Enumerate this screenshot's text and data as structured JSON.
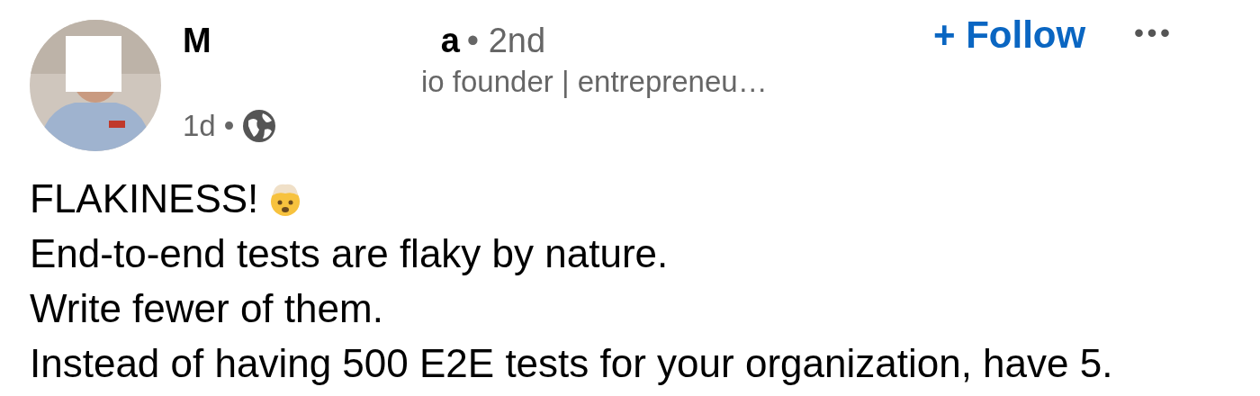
{
  "author": {
    "name_start": "M",
    "name_end": "a",
    "degree": "• 2nd",
    "headline": "io founder | entrepreneu…",
    "time": "1d •"
  },
  "follow_button": {
    "label": "+ Follow"
  },
  "more_button": {
    "label": "•••"
  },
  "post": {
    "lines": [
      {
        "text": "FLAKINESS!",
        "emoji": true
      },
      {
        "text": "End-to-end tests are flaky by nature.",
        "emoji": false
      },
      {
        "text": "Write fewer of them.",
        "emoji": false
      },
      {
        "text": "Instead of having 500 E2E tests for your organization, have 5.",
        "emoji": false
      }
    ]
  }
}
